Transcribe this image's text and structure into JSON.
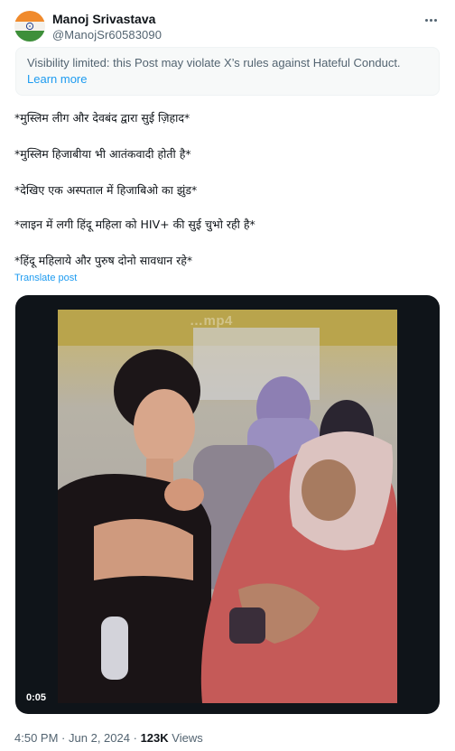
{
  "post": {
    "author_name": "Manoj Srivastava",
    "author_handle": "@ManojSr60583090",
    "avatar_icon": "india-flag-avatar",
    "more_icon": "more-options-icon",
    "notice": {
      "text": "Visibility limited: this Post may violate X’s rules against Hateful Conduct.",
      "link": "Learn more"
    },
    "lines": [
      "*मुस्लिम लीग और देवबंद द्वारा सुई ज़िहाद*",
      "*मुस्लिम हिजाबीया भी आतंकवादी होती है*",
      "*देखिए एक अस्पताल में हिजाबिओ का झुंड*",
      "*लाइन में लगी हिंदू महिला को HIV+ की सुई चुभो रही है*",
      "*हिंदू महिलाये और पुरुष दोनो सावधान रहे*"
    ],
    "translate_label": "Translate post",
    "media": {
      "watermark": "…mp4",
      "duration": "0:05"
    },
    "time": "4:50 PM",
    "separator": "·",
    "date": "Jun 2, 2024",
    "views_count": "123K",
    "views_label": "Views"
  },
  "colors": {
    "link": "#1d9bf0",
    "secondary_text": "#536471",
    "primary_text": "#0f1419"
  }
}
